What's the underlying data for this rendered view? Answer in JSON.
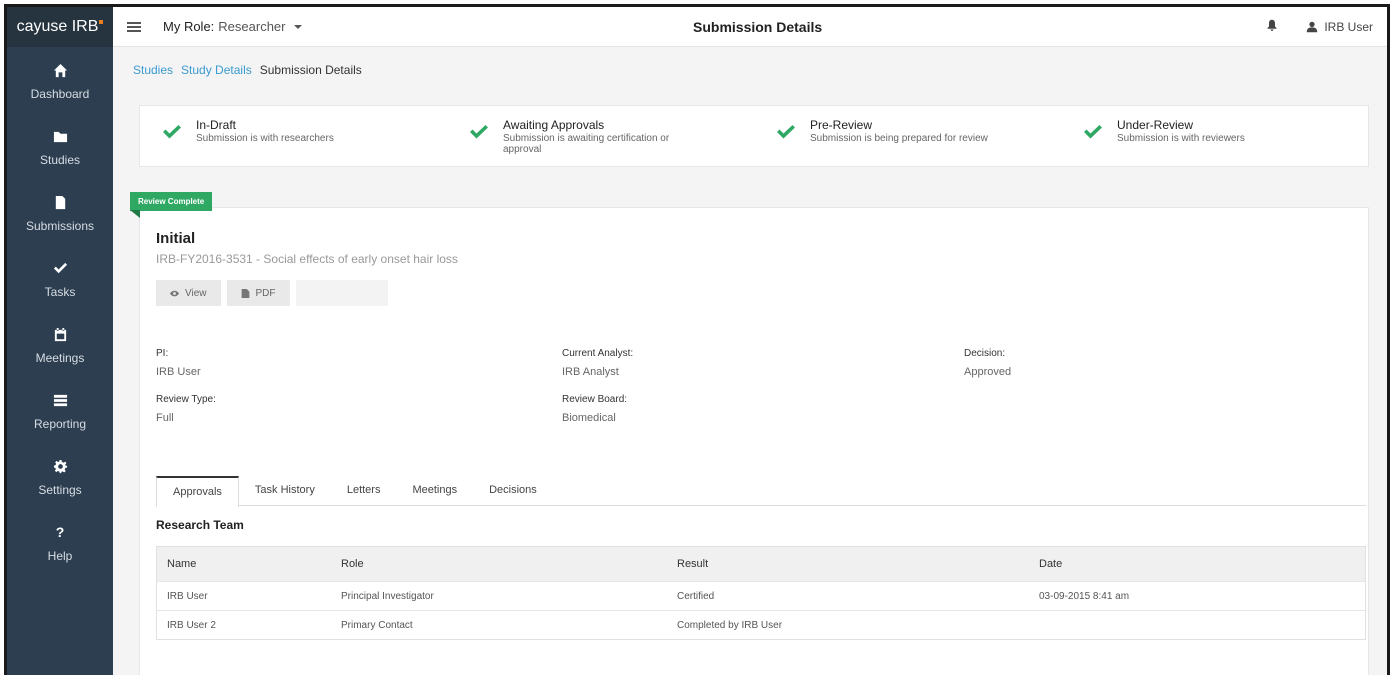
{
  "app": {
    "logo": "cayuse IRB",
    "brand_accent": "#e67e22"
  },
  "sidebar": {
    "items": [
      {
        "label": "Dashboard",
        "icon": "home-icon"
      },
      {
        "label": "Studies",
        "icon": "folder-icon"
      },
      {
        "label": "Submissions",
        "icon": "document-icon"
      },
      {
        "label": "Tasks",
        "icon": "check-icon"
      },
      {
        "label": "Meetings",
        "icon": "calendar-icon"
      },
      {
        "label": "Reporting",
        "icon": "list-icon"
      },
      {
        "label": "Settings",
        "icon": "gear-icon"
      },
      {
        "label": "Help",
        "icon": "question-icon"
      }
    ]
  },
  "topbar": {
    "role_label": "My Role:",
    "role_value": "Researcher",
    "title": "Submission Details",
    "user": "IRB User"
  },
  "breadcrumb": [
    "Studies",
    "Study Details",
    "Submission Details"
  ],
  "steps": [
    {
      "title": "In-Draft",
      "desc": "Submission is with researchers"
    },
    {
      "title": "Awaiting Approvals",
      "desc": "Submission is awaiting certification or approval"
    },
    {
      "title": "Pre-Review",
      "desc": "Submission is being prepared for review"
    },
    {
      "title": "Under-Review",
      "desc": "Submission is with reviewers"
    }
  ],
  "submission": {
    "status_badge": "Review Complete",
    "title": "Initial",
    "description": "IRB-FY2016-3531 - Social effects of early onset hair loss",
    "view_label": "View",
    "pdf_label": "PDF"
  },
  "details": {
    "pi_label": "PI:",
    "pi_value": "IRB User",
    "analyst_label": "Current Analyst:",
    "analyst_value": "IRB Analyst",
    "decision_label": "Decision:",
    "decision_value": "Approved",
    "review_type_label": "Review Type:",
    "review_type_value": "Full",
    "review_board_label": "Review Board:",
    "review_board_value": "Biomedical"
  },
  "tabs": [
    "Approvals",
    "Task History",
    "Letters",
    "Meetings",
    "Decisions"
  ],
  "team": {
    "title": "Research Team",
    "columns": [
      "Name",
      "Role",
      "Result",
      "Date"
    ],
    "rows": [
      [
        "IRB User",
        "Principal Investigator",
        "Certified",
        "03-09-2015 8:41 am"
      ],
      [
        "IRB User 2",
        "Primary Contact",
        "Completed by IRB User",
        ""
      ]
    ]
  },
  "colors": {
    "success": "#2ea863",
    "sidebar": "#2c3e50",
    "link": "#3a9bd1"
  }
}
